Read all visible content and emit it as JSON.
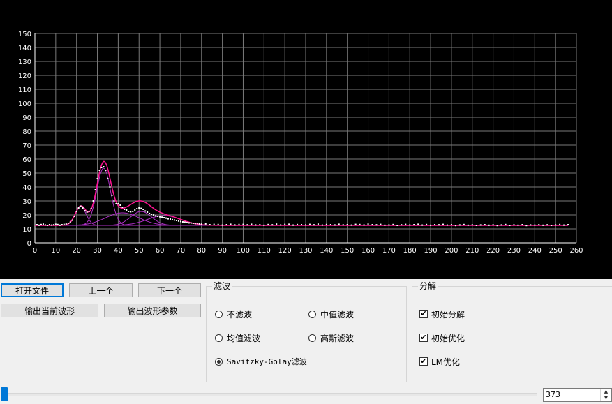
{
  "chart_data": {
    "type": "scatter",
    "xlim": [
      0,
      260
    ],
    "ylim": [
      0,
      150
    ],
    "xticks": [
      0,
      10,
      20,
      30,
      40,
      50,
      60,
      70,
      80,
      90,
      100,
      110,
      120,
      130,
      140,
      150,
      160,
      170,
      180,
      190,
      200,
      210,
      220,
      230,
      240,
      250,
      260
    ],
    "yticks": [
      0,
      10,
      20,
      30,
      40,
      50,
      60,
      70,
      80,
      90,
      100,
      110,
      120,
      130,
      140,
      150
    ],
    "grid": true,
    "colors": {
      "background": "#000000",
      "grid": "#7a7a7a",
      "axis": "#ffffff",
      "points": "#ffffff",
      "fit": "#ff1493",
      "components": "#b030c8"
    },
    "baseline": 12.5,
    "components": [
      {
        "center": 22,
        "amplitude": 13.5,
        "sigma": 2.6
      },
      {
        "center": 33,
        "amplitude": 41,
        "sigma": 3.3
      },
      {
        "center": 42,
        "amplitude": 9,
        "sigma": 8
      },
      {
        "center": 51,
        "amplitude": 10,
        "sigma": 5
      },
      {
        "center": 62,
        "amplitude": 7,
        "sigma": 8
      }
    ],
    "series": [
      {
        "values": [
          [
            1,
            13
          ],
          [
            2,
            12.6
          ],
          [
            3,
            13.1
          ],
          [
            4,
            13.4
          ],
          [
            5,
            12.8
          ],
          [
            6,
            12.5
          ],
          [
            7,
            13
          ],
          [
            8,
            12.7
          ],
          [
            9,
            12.9
          ],
          [
            10,
            13.3
          ],
          [
            11,
            13.1
          ],
          [
            12,
            12.6
          ],
          [
            13,
            13
          ],
          [
            14,
            13.2
          ],
          [
            15,
            13.5
          ],
          [
            16,
            14
          ],
          [
            17,
            14.8
          ],
          [
            18,
            16.2
          ],
          [
            19,
            19
          ],
          [
            20,
            22.5
          ],
          [
            21,
            25
          ],
          [
            22,
            26.2
          ],
          [
            23,
            25
          ],
          [
            24,
            23
          ],
          [
            25,
            22
          ],
          [
            26,
            22.5
          ],
          [
            27,
            24.5
          ],
          [
            28,
            30
          ],
          [
            29,
            38
          ],
          [
            30,
            46
          ],
          [
            31,
            52
          ],
          [
            32,
            54
          ],
          [
            33,
            54.5
          ],
          [
            34,
            52
          ],
          [
            35,
            46
          ],
          [
            36,
            40
          ],
          [
            37,
            34
          ],
          [
            38,
            30
          ],
          [
            39,
            28
          ],
          [
            40,
            28
          ],
          [
            41,
            27
          ],
          [
            42,
            25.5
          ],
          [
            43,
            24
          ],
          [
            44,
            23.5
          ],
          [
            45,
            22.5
          ],
          [
            46,
            22.3
          ],
          [
            47,
            22.5
          ],
          [
            48,
            23.5
          ],
          [
            49,
            24.5
          ],
          [
            50,
            25
          ],
          [
            51,
            24.7
          ],
          [
            52,
            24
          ],
          [
            53,
            22.8
          ],
          [
            54,
            22
          ],
          [
            55,
            21
          ],
          [
            56,
            20.5
          ],
          [
            57,
            20
          ],
          [
            58,
            19.3
          ],
          [
            59,
            19
          ],
          [
            60,
            18.6
          ],
          [
            61,
            18.4
          ],
          [
            62,
            18
          ],
          [
            63,
            17.7
          ],
          [
            64,
            17.2
          ],
          [
            65,
            17
          ],
          [
            66,
            16.6
          ],
          [
            67,
            16.3
          ],
          [
            68,
            16
          ],
          [
            69,
            15.6
          ],
          [
            70,
            15.3
          ],
          [
            71,
            15
          ],
          [
            72,
            14.8
          ],
          [
            73,
            14.5
          ],
          [
            74,
            14.3
          ],
          [
            75,
            14.2
          ],
          [
            76,
            14
          ],
          [
            77,
            13.8
          ],
          [
            78,
            13.9
          ],
          [
            79,
            13.6
          ],
          [
            80,
            13.4
          ],
          [
            82,
            13.6
          ],
          [
            84,
            13
          ],
          [
            86,
            13.2
          ],
          [
            88,
            13.1
          ],
          [
            90,
            12.7
          ],
          [
            92,
            13
          ],
          [
            94,
            13.3
          ],
          [
            96,
            12.8
          ],
          [
            98,
            13.1
          ],
          [
            100,
            13.2
          ],
          [
            102,
            12.9
          ],
          [
            104,
            13.3
          ],
          [
            106,
            12.8
          ],
          [
            108,
            13
          ],
          [
            110,
            12.6
          ],
          [
            112,
            13.1
          ],
          [
            114,
            12.9
          ],
          [
            116,
            13.4
          ],
          [
            118,
            12.8
          ],
          [
            120,
            13.2
          ],
          [
            122,
            13.3
          ],
          [
            124,
            12.7
          ],
          [
            126,
            13.1
          ],
          [
            128,
            13
          ],
          [
            130,
            12.8
          ],
          [
            132,
            13.2
          ],
          [
            134,
            12.9
          ],
          [
            136,
            13.4
          ],
          [
            138,
            12.7
          ],
          [
            140,
            13.1
          ],
          [
            142,
            13
          ],
          [
            144,
            12.8
          ],
          [
            146,
            13.3
          ],
          [
            148,
            12.9
          ],
          [
            150,
            13
          ],
          [
            152,
            12.7
          ],
          [
            154,
            13.2
          ],
          [
            156,
            13.1
          ],
          [
            158,
            12.8
          ],
          [
            160,
            13.4
          ],
          [
            162,
            13
          ],
          [
            164,
            12.9
          ],
          [
            166,
            13.2
          ],
          [
            168,
            12.6
          ],
          [
            170,
            12.8
          ],
          [
            172,
            13.1
          ],
          [
            174,
            12.5
          ],
          [
            176,
            12.9
          ],
          [
            178,
            13.2
          ],
          [
            180,
            12.8
          ],
          [
            182,
            13
          ],
          [
            184,
            13.3
          ],
          [
            186,
            12.7
          ],
          [
            188,
            13.1
          ],
          [
            190,
            12.6
          ],
          [
            192,
            13
          ],
          [
            194,
            12.9
          ],
          [
            196,
            13.2
          ],
          [
            198,
            12.7
          ],
          [
            200,
            13
          ],
          [
            202,
            12.4
          ],
          [
            204,
            12.8
          ],
          [
            206,
            13.1
          ],
          [
            208,
            12.6
          ],
          [
            210,
            12.9
          ],
          [
            212,
            12.5
          ],
          [
            214,
            12.8
          ],
          [
            216,
            13
          ],
          [
            218,
            12.6
          ],
          [
            220,
            12.9
          ],
          [
            222,
            12.4
          ],
          [
            224,
            12.8
          ],
          [
            226,
            13.1
          ],
          [
            228,
            12.5
          ],
          [
            230,
            12.9
          ],
          [
            232,
            12.6
          ],
          [
            234,
            13
          ],
          [
            236,
            12.4
          ],
          [
            238,
            12.8
          ],
          [
            240,
            12.7
          ],
          [
            242,
            13
          ],
          [
            244,
            12.6
          ],
          [
            246,
            12.9
          ],
          [
            248,
            12.5
          ],
          [
            250,
            12.8
          ],
          [
            252,
            13.1
          ],
          [
            254,
            12.7
          ],
          [
            256,
            13
          ]
        ]
      }
    ]
  },
  "buttons": {
    "open_file": "打开文件",
    "prev": "上一个",
    "next": "下一个",
    "export_current": "输出当前波形",
    "export_params": "输出波形参数"
  },
  "filter_group": {
    "title": "滤波",
    "options": [
      {
        "label": "不滤波",
        "checked": false
      },
      {
        "label": "中值滤波",
        "checked": false
      },
      {
        "label": "均值滤波",
        "checked": false
      },
      {
        "label": "高斯滤波",
        "checked": false
      },
      {
        "label": "Savitzky-Golay滤波",
        "checked": true
      }
    ]
  },
  "decompose_group": {
    "title": "分解",
    "options": [
      {
        "label": "初始分解",
        "checked": true
      },
      {
        "label": "初始优化",
        "checked": true
      },
      {
        "label": "LM优化",
        "checked": true
      }
    ]
  },
  "slider": {
    "value_fraction": 0.0
  },
  "spin": {
    "value": "373",
    "up_icon": "arrow-up-icon",
    "down_icon": "arrow-down-icon"
  }
}
